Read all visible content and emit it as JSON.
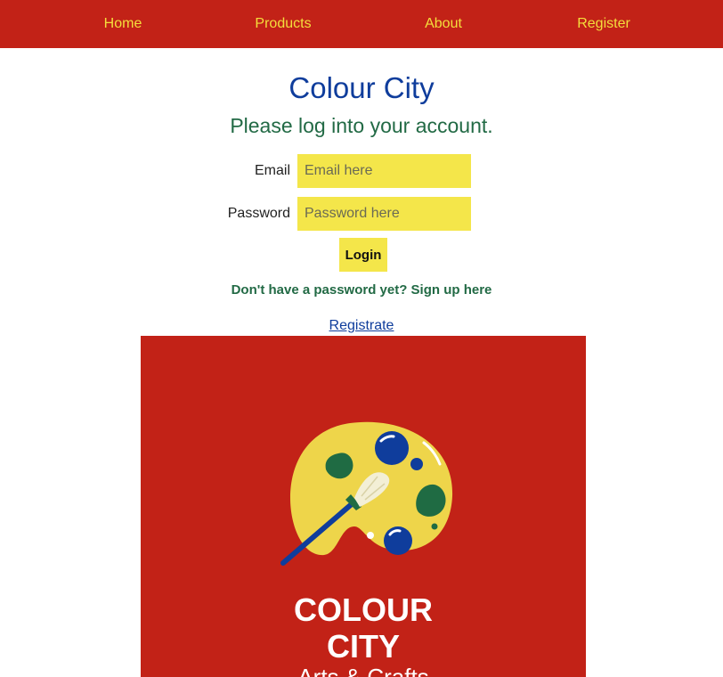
{
  "nav": {
    "items": [
      {
        "label": "Home"
      },
      {
        "label": "Products"
      },
      {
        "label": "About"
      },
      {
        "label": "Register"
      }
    ]
  },
  "header": {
    "title": "Colour City",
    "subtitle": "Please log into your account."
  },
  "login_form": {
    "email_label": "Email",
    "email_placeholder": "Email here",
    "password_label": "Password",
    "password_placeholder": "Password here",
    "login_label": "Login"
  },
  "signup": {
    "hint_text": "Don't have a password yet? Sign up here",
    "register_link": "Registrate"
  },
  "logo": {
    "line1": "COLOUR",
    "line2": "CITY",
    "tagline": "Arts & Crafts"
  },
  "colors": {
    "brand_red": "#c22217",
    "brand_yellow": "#f4e64a",
    "title_blue": "#0f3d9c",
    "text_green": "#226a45"
  }
}
